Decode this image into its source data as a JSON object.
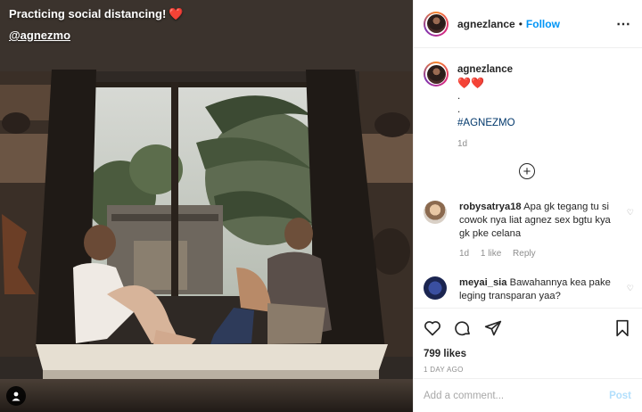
{
  "photo": {
    "caption_line1": "Practicing social distancing!",
    "caption_heart": "❤️",
    "caption_line2": "@agnezmo",
    "tag_icon": "user-tag-icon"
  },
  "header": {
    "username": "agnezlance",
    "dot": "•",
    "follow_label": "Follow",
    "more_icon": "more-horizontal-icon"
  },
  "post_caption": {
    "username": "agnezlance",
    "hearts": "❤️❤️",
    "line_dot1": ".",
    "line_dot2": ".",
    "hashtag": "#AGNEZMO",
    "timestamp": "1d"
  },
  "load_more_icon": "plus-circle-icon",
  "comments": [
    {
      "username": "robysatrya18",
      "text": "Apa gk tegang tu si cowok nya liat agnez sex bgtu kya gk pke celana",
      "time": "1d",
      "likes": "1 like",
      "reply": "Reply"
    },
    {
      "username": "meyai_sia",
      "text": "Bawahannya kea pake leging transparan yaa?"
    }
  ],
  "actions": {
    "icons": [
      "heart-icon",
      "comment-icon",
      "share-icon",
      "bookmark-icon"
    ],
    "likes": "799 likes",
    "ago": "1 DAY AGO"
  },
  "add_comment": {
    "placeholder": "Add a comment...",
    "post_label": "Post"
  },
  "colors": {
    "accent": "#0095f6",
    "post_disabled": "#b2dffc",
    "heart": "#e8284a",
    "muted": "#8e8e8e",
    "hashtag": "#00376b"
  }
}
